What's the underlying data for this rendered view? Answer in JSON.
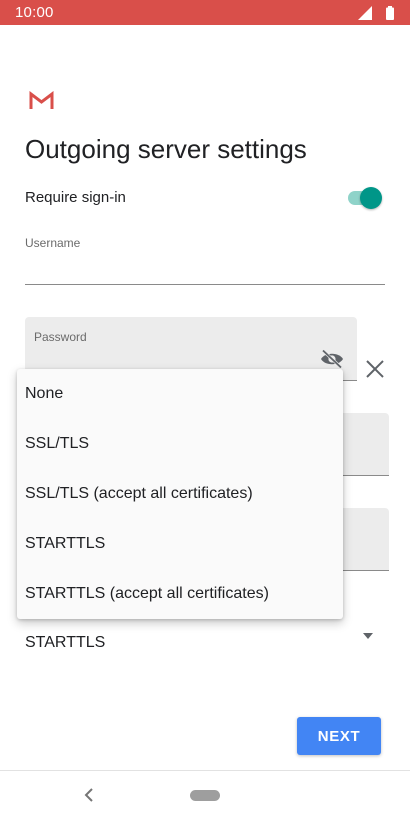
{
  "status_bar": {
    "time": "10:00",
    "icons": [
      "signal-icon",
      "battery-icon"
    ],
    "color": "#d94f4a"
  },
  "app": {
    "logo": "gmail-logo"
  },
  "page": {
    "title": "Outgoing server settings"
  },
  "require_signin": {
    "label": "Require sign-in",
    "enabled": true,
    "accent": "#009688"
  },
  "username": {
    "label": "Username",
    "value": ""
  },
  "password": {
    "label": "Password",
    "value": "",
    "icons": [
      "eye-slash-icon",
      "close-icon"
    ]
  },
  "security": {
    "selected": "STARTTLS",
    "options": [
      "None",
      "SSL/TLS",
      "SSL/TLS (accept all certificates)",
      "STARTTLS",
      "STARTTLS (accept all certificates)"
    ]
  },
  "actions": {
    "next_label": "NEXT",
    "next_color": "#4285f4"
  },
  "nav": {
    "icons": [
      "back-icon",
      "home-pill"
    ]
  }
}
